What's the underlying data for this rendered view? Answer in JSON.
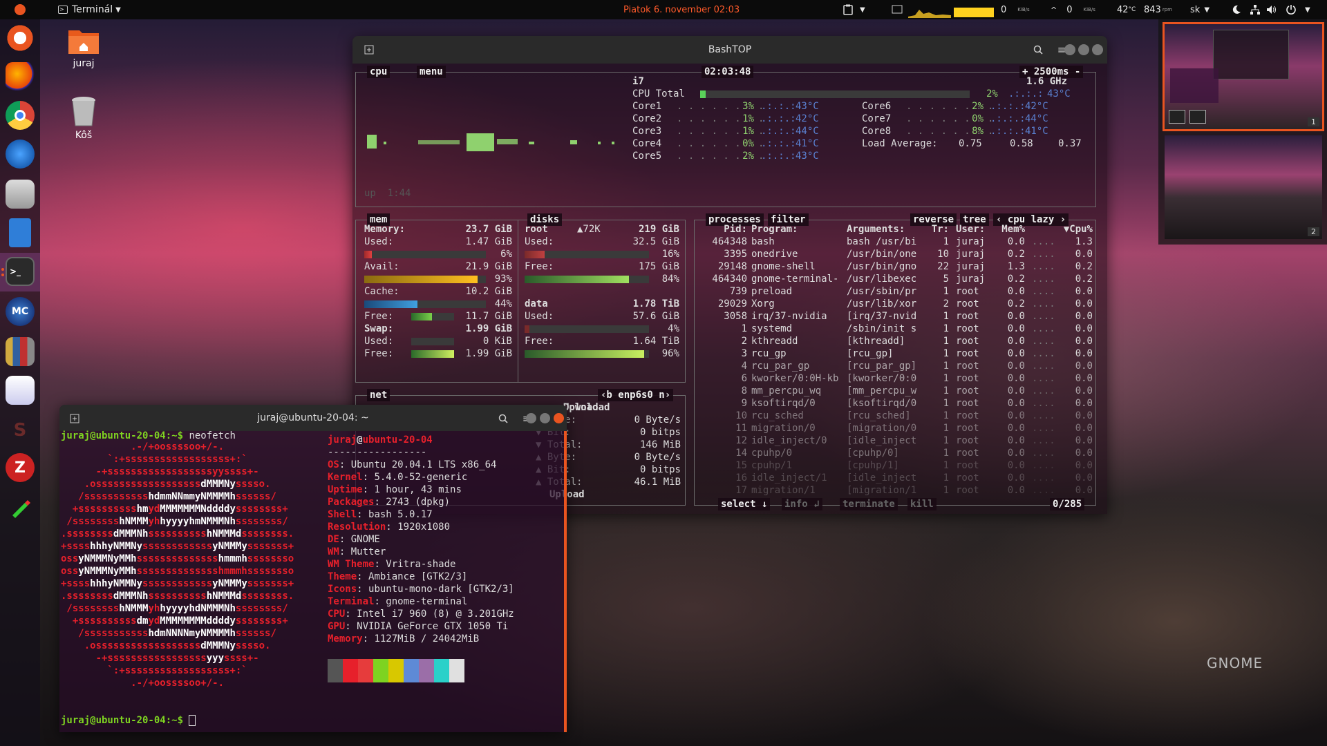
{
  "topbar": {
    "app": "Terminál",
    "clock": "Piatok  6. november  02:03",
    "net_down": "0",
    "net_down_unit": "KiB/s",
    "net_up": "0",
    "net_up_unit": "KiB/s",
    "temp": "42",
    "temp_unit": "°C",
    "fan": "843",
    "fan_unit": "rpm",
    "keyboard": "sk"
  },
  "desktop": {
    "home_label": "juraj",
    "trash_label": "Kôš",
    "watermark": "GNOME"
  },
  "bashtop": {
    "title": "BashTOP",
    "cpu_label": "cpu",
    "menu_label": "menu",
    "time": "02:03:48",
    "interval": "+ 2500ms -",
    "cpu_model": "i7",
    "freq": "1.6 GHz",
    "cpu_total_label": "CPU Total",
    "cpu_total_pct": "2%",
    "cpu_total_fill": 0.02,
    "cpu_total_temp": "43°C",
    "cores": [
      {
        "name": "Core1",
        "pct": "3%",
        "temp": "43°C"
      },
      {
        "name": "Core2",
        "pct": "1%",
        "temp": "42°C"
      },
      {
        "name": "Core3",
        "pct": "1%",
        "temp": "44°C"
      },
      {
        "name": "Core4",
        "pct": "0%",
        "temp": "41°C"
      },
      {
        "name": "Core5",
        "pct": "2%",
        "temp": "43°C"
      },
      {
        "name": "Core6",
        "pct": "2%",
        "temp": "42°C"
      },
      {
        "name": "Core7",
        "pct": "0%",
        "temp": "44°C"
      },
      {
        "name": "Core8",
        "pct": "8%",
        "temp": "41°C"
      }
    ],
    "load_label": "Load Average:",
    "load": [
      "0.75",
      "0.58",
      "0.37"
    ],
    "uptime": "up  1:44",
    "mem": {
      "label": "mem",
      "memory_label": "Memory:",
      "memory": "23.7 GiB",
      "used_label": "Used:",
      "used": "1.47 GiB",
      "used_pct": "6%",
      "used_fill": 0.06,
      "avail_label": "Avail:",
      "avail": "21.9 GiB",
      "avail_pct": "93%",
      "avail_fill": 0.93,
      "cache_label": "Cache:",
      "cache": "10.2 GiB",
      "cache_pct": "44%",
      "cache_fill": 0.44,
      "free_label": "Free:",
      "free": "11.7 GiB",
      "free_fill": 0.49,
      "swap_label": "Swap:",
      "swap": "1.99 GiB",
      "swap_used_label": "Used:",
      "swap_used": "0 KiB",
      "swap_used_fill": 0,
      "swap_free_label": "Free:",
      "swap_free": "1.99 GiB",
      "swap_free_fill": 1.0
    },
    "disks": {
      "label": "disks",
      "root_label": "root",
      "root_io": "▲72K",
      "root_size": "219 GiB",
      "root_used_label": "Used:",
      "root_used": "32.5 GiB",
      "root_used_pct": "16%",
      "root_used_fill": 0.16,
      "root_free_label": "Free:",
      "root_free": "175 GiB",
      "root_free_pct": "84%",
      "root_free_fill": 0.84,
      "data_label": "data",
      "data_size": "1.78 TiB",
      "data_used_label": "Used:",
      "data_used": "57.6 GiB",
      "data_used_pct": "4%",
      "data_used_fill": 0.04,
      "data_free_label": "Free:",
      "data_free": "1.64 TiB",
      "data_free_pct": "96%",
      "data_free_fill": 0.96
    },
    "net": {
      "label": "net",
      "iface": "‹b enp6s0 n›",
      "download": "Download",
      "upload_header": "Upload",
      "upload": "Upload",
      "rows": [
        {
          "label": "▼ Byte:",
          "value": "0 Byte/s"
        },
        {
          "label": "▼ Bit:",
          "value": "0 bitps"
        },
        {
          "label": "▼ Total:",
          "value": "146 MiB"
        },
        {
          "label": "▲ Byte:",
          "value": "0 Byte/s"
        },
        {
          "label": "▲ Bit:",
          "value": "0 bitps"
        },
        {
          "label": "▲ Total:",
          "value": "46.1 MiB"
        }
      ]
    },
    "proc": {
      "label": "processes",
      "filter": "filter",
      "reverse": "reverse",
      "tree": "tree",
      "sort": "‹ cpu lazy ›",
      "headers": {
        "pid": "Pid:",
        "program": "Program:",
        "args": "Arguments:",
        "threads": "Tr:",
        "user": "User:",
        "mem": "Mem%",
        "cpu": "▼Cpu%"
      },
      "rows": [
        {
          "pid": "464348",
          "prog": "bash",
          "args": "bash /usr/bi",
          "tr": "1",
          "user": "juraj",
          "mem": "0.0",
          "cpu": "1.3"
        },
        {
          "pid": "3395",
          "prog": "onedrive",
          "args": "/usr/bin/one",
          "tr": "10",
          "user": "juraj",
          "mem": "0.2",
          "cpu": "0.0"
        },
        {
          "pid": "29148",
          "prog": "gnome-shell",
          "args": "/usr/bin/gno",
          "tr": "22",
          "user": "juraj",
          "mem": "1.3",
          "cpu": "0.2"
        },
        {
          "pid": "464340",
          "prog": "gnome-terminal-",
          "args": "/usr/libexec",
          "tr": "5",
          "user": "juraj",
          "mem": "0.2",
          "cpu": "0.2"
        },
        {
          "pid": "739",
          "prog": "preload",
          "args": "/usr/sbin/pr",
          "tr": "1",
          "user": "root",
          "mem": "0.0",
          "cpu": "0.0"
        },
        {
          "pid": "29029",
          "prog": "Xorg",
          "args": "/usr/lib/xor",
          "tr": "2",
          "user": "root",
          "mem": "0.2",
          "cpu": "0.0"
        },
        {
          "pid": "3058",
          "prog": "irq/37-nvidia",
          "args": "[irq/37-nvid",
          "tr": "1",
          "user": "root",
          "mem": "0.0",
          "cpu": "0.0"
        },
        {
          "pid": "1",
          "prog": "systemd",
          "args": "/sbin/init s",
          "tr": "1",
          "user": "root",
          "mem": "0.0",
          "cpu": "0.0"
        },
        {
          "pid": "2",
          "prog": "kthreadd",
          "args": "[kthreadd]",
          "tr": "1",
          "user": "root",
          "mem": "0.0",
          "cpu": "0.0"
        },
        {
          "pid": "3",
          "prog": "rcu_gp",
          "args": "[rcu_gp]",
          "tr": "1",
          "user": "root",
          "mem": "0.0",
          "cpu": "0.0"
        },
        {
          "pid": "4",
          "prog": "rcu_par_gp",
          "args": "[rcu_par_gp]",
          "tr": "1",
          "user": "root",
          "mem": "0.0",
          "cpu": "0.0"
        },
        {
          "pid": "6",
          "prog": "kworker/0:0H-kb",
          "args": "[kworker/0:0",
          "tr": "1",
          "user": "root",
          "mem": "0.0",
          "cpu": "0.0"
        },
        {
          "pid": "8",
          "prog": "mm_percpu_wq",
          "args": "[mm_percpu_w",
          "tr": "1",
          "user": "root",
          "mem": "0.0",
          "cpu": "0.0"
        },
        {
          "pid": "9",
          "prog": "ksoftirqd/0",
          "args": "[ksoftirqd/0",
          "tr": "1",
          "user": "root",
          "mem": "0.0",
          "cpu": "0.0"
        },
        {
          "pid": "10",
          "prog": "rcu_sched",
          "args": "[rcu_sched]",
          "tr": "1",
          "user": "root",
          "mem": "0.0",
          "cpu": "0.0"
        },
        {
          "pid": "11",
          "prog": "migration/0",
          "args": "[migration/0",
          "tr": "1",
          "user": "root",
          "mem": "0.0",
          "cpu": "0.0"
        },
        {
          "pid": "12",
          "prog": "idle_inject/0",
          "args": "[idle_inject",
          "tr": "1",
          "user": "root",
          "mem": "0.0",
          "cpu": "0.0"
        },
        {
          "pid": "14",
          "prog": "cpuhp/0",
          "args": "[cpuhp/0]",
          "tr": "1",
          "user": "root",
          "mem": "0.0",
          "cpu": "0.0"
        },
        {
          "pid": "15",
          "prog": "cpuhp/1",
          "args": "[cpuhp/1]",
          "tr": "1",
          "user": "root",
          "mem": "0.0",
          "cpu": "0.0"
        },
        {
          "pid": "16",
          "prog": "idle_inject/1",
          "args": "[idle_inject",
          "tr": "1",
          "user": "root",
          "mem": "0.0",
          "cpu": "0.0"
        },
        {
          "pid": "17",
          "prog": "migration/1",
          "args": "[migration/1",
          "tr": "1",
          "user": "root",
          "mem": "0.0",
          "cpu": "0.0"
        }
      ],
      "select": "select ↓",
      "info": "info ↲",
      "terminate": "terminate",
      "kill": "kill",
      "count": "0/285"
    }
  },
  "terminal": {
    "title": "juraj@ubuntu-20-04: ~",
    "prompt": "juraj@ubuntu-20-04:~$",
    "cmd1": "neofetch",
    "user": "juraj",
    "at": "@",
    "host": "ubuntu-20-04",
    "sep": "-----------------",
    "info": [
      {
        "k": "OS",
        "v": "Ubuntu 20.04.1 LTS x86_64"
      },
      {
        "k": "Kernel",
        "v": "5.4.0-52-generic"
      },
      {
        "k": "Uptime",
        "v": "1 hour, 43 mins"
      },
      {
        "k": "Packages",
        "v": "2743 (dpkg)"
      },
      {
        "k": "Shell",
        "v": "bash 5.0.17"
      },
      {
        "k": "Resolution",
        "v": "1920x1080"
      },
      {
        "k": "DE",
        "v": "GNOME"
      },
      {
        "k": "WM",
        "v": "Mutter"
      },
      {
        "k": "WM Theme",
        "v": "Vritra-shade"
      },
      {
        "k": "Theme",
        "v": "Ambiance [GTK2/3]"
      },
      {
        "k": "Icons",
        "v": "ubuntu-mono-dark [GTK2/3]"
      },
      {
        "k": "Terminal",
        "v": "gnome-terminal"
      },
      {
        "k": "CPU",
        "v": "Intel i7 960 (8) @ 3.201GHz"
      },
      {
        "k": "GPU",
        "v": "NVIDIA GeForce GTX 1050 Ti"
      },
      {
        "k": "Memory",
        "v": "1127MiB / 24042MiB"
      }
    ],
    "logo": [
      "            .-/+oossssoo+/-.",
      "        `:+ssssssssssssssssss+:`",
      "      -+ssssssssssssssssssyyssss+-",
      "    .ossssssssssssssssss|dMMMNy|sssso.",
      "   /sssssssssss|hdmmNNmmyNMMMMh|ssssss/",
      "  +ssssssssss|hm|yd|MMMMMMMNddddy|ssssssss+",
      " /ssssssss|hNMMM|yh|hyyyyhmNMMMNh|ssssssss/",
      ".ssssssss|dMMMNh|ssssssssss|hNMMMd|ssssssss.",
      "+ssss|hhhyNMMNy|ssssssssssss|yNMMMy|sssssss+",
      "oss|yNMMMNyMMh|ssssssssssssss|hmmmh|ssssssso",
      "oss|yNMMMNyMMh|sssssssssssssshmmmhssssssso",
      "+ssss|hhhyNMMNy|ssssssssssss|yNMMMy|sssssss+",
      ".ssssssss|dMMMNh|ssssssssss|hNMMMd|ssssssss.",
      " /ssssssss|hNMMM|yh|hyyyyhdNMMMNh|ssssssss/",
      "  +ssssssssss|dm|yd|MMMMMMMMddddy|ssssssss+",
      "   /sssssssssss|hdmNNNNmyNMMMMh|ssssss/",
      "    .ossssssssssssssssss|dMMMNy|sssso.",
      "      -+sssssssssssssssss|yyy|ssss+-",
      "        `:+ssssssssssssssssss+:`",
      "            .-/+oossssoo+/-."
    ],
    "palette": [
      "#555555",
      "#e7202b",
      "#e63c3c",
      "#7ed321",
      "#d8c800",
      "#5e8ad6",
      "#9b6ea8",
      "#2ad1c9",
      "#e0e0e0"
    ]
  },
  "workspaces": {
    "ws1": "1",
    "ws2": "2"
  }
}
